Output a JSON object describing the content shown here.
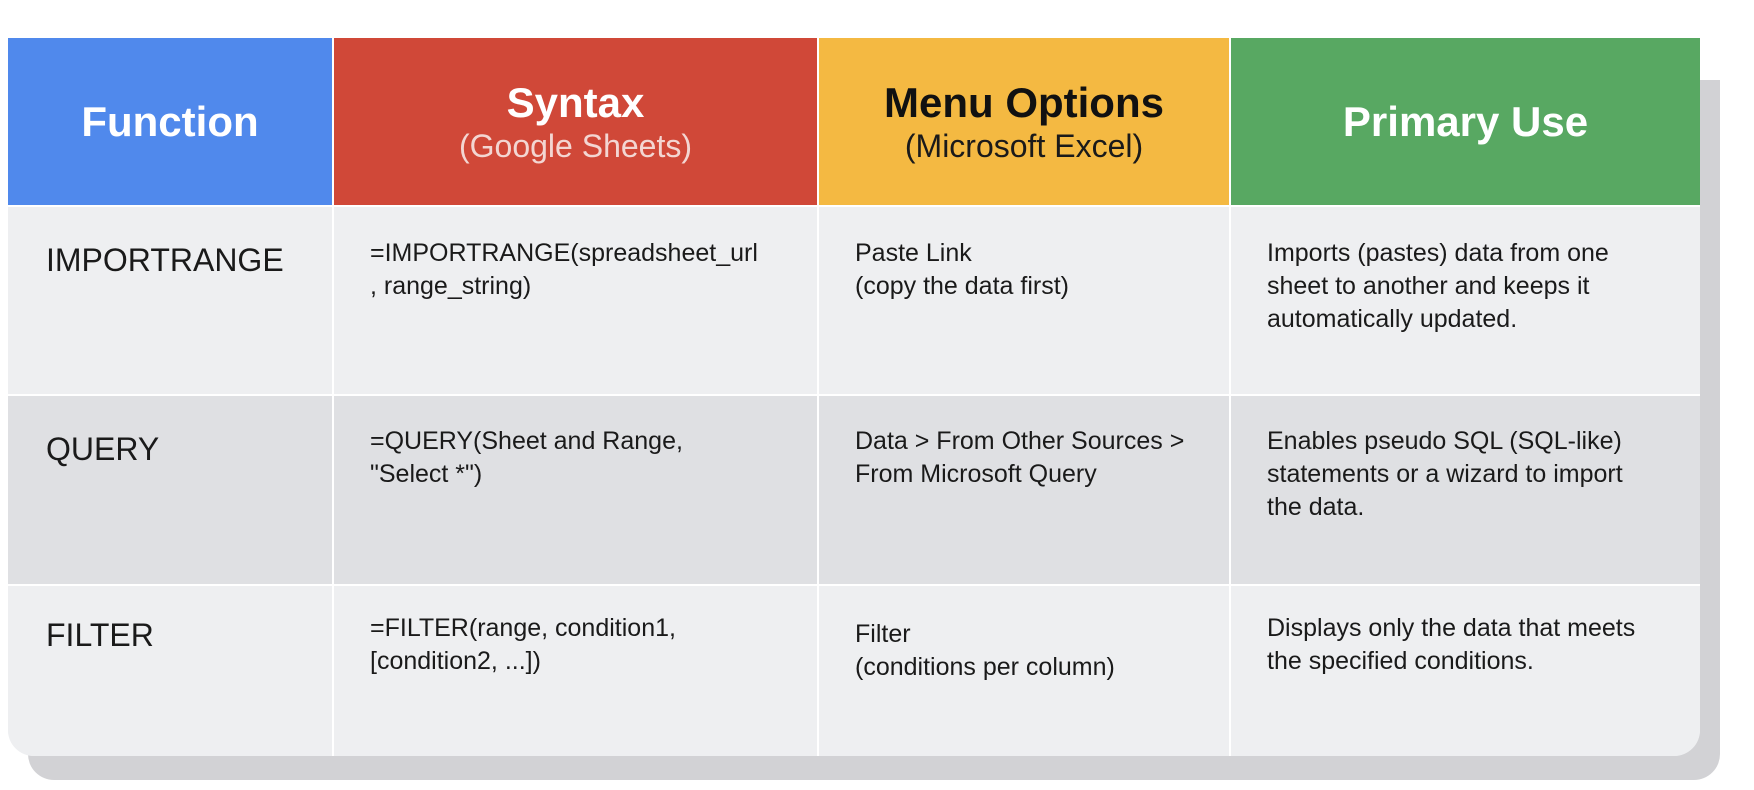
{
  "headers": [
    {
      "title": "Function",
      "subtitle": ""
    },
    {
      "title": "Syntax",
      "subtitle": "(Google Sheets)"
    },
    {
      "title": "Menu Options",
      "subtitle": "(Microsoft Excel)"
    },
    {
      "title": "Primary Use",
      "subtitle": ""
    }
  ],
  "colors": {
    "function_header": "#5089ec",
    "syntax_header": "#d04838",
    "menu_header": "#f4b942",
    "use_header": "#58a862",
    "row_light": "#eeeff1",
    "row_dark": "#dfe0e3"
  },
  "rows": [
    {
      "function": "IMPORTRANGE",
      "syntax": "=IMPORTRANGE(spreadsheet_url\n, range_string)",
      "menu": "Paste Link\n(copy the data first)",
      "use": "Imports (pastes) data from one\nsheet to another and keeps it\nautomatically updated."
    },
    {
      "function": "QUERY",
      "syntax": "=QUERY(Sheet and Range,\n\"Select *\")",
      "menu": "Data > From Other Sources >\nFrom Microsoft Query",
      "use": "Enables pseudo SQL (SQL-like)\nstatements or a wizard to import\nthe data."
    },
    {
      "function": "FILTER",
      "syntax": "=FILTER(range, condition1,\n[condition2, ...])",
      "menu": "Filter\n(conditions per column)",
      "use": "Displays only the data that meets\nthe specified conditions."
    }
  ]
}
